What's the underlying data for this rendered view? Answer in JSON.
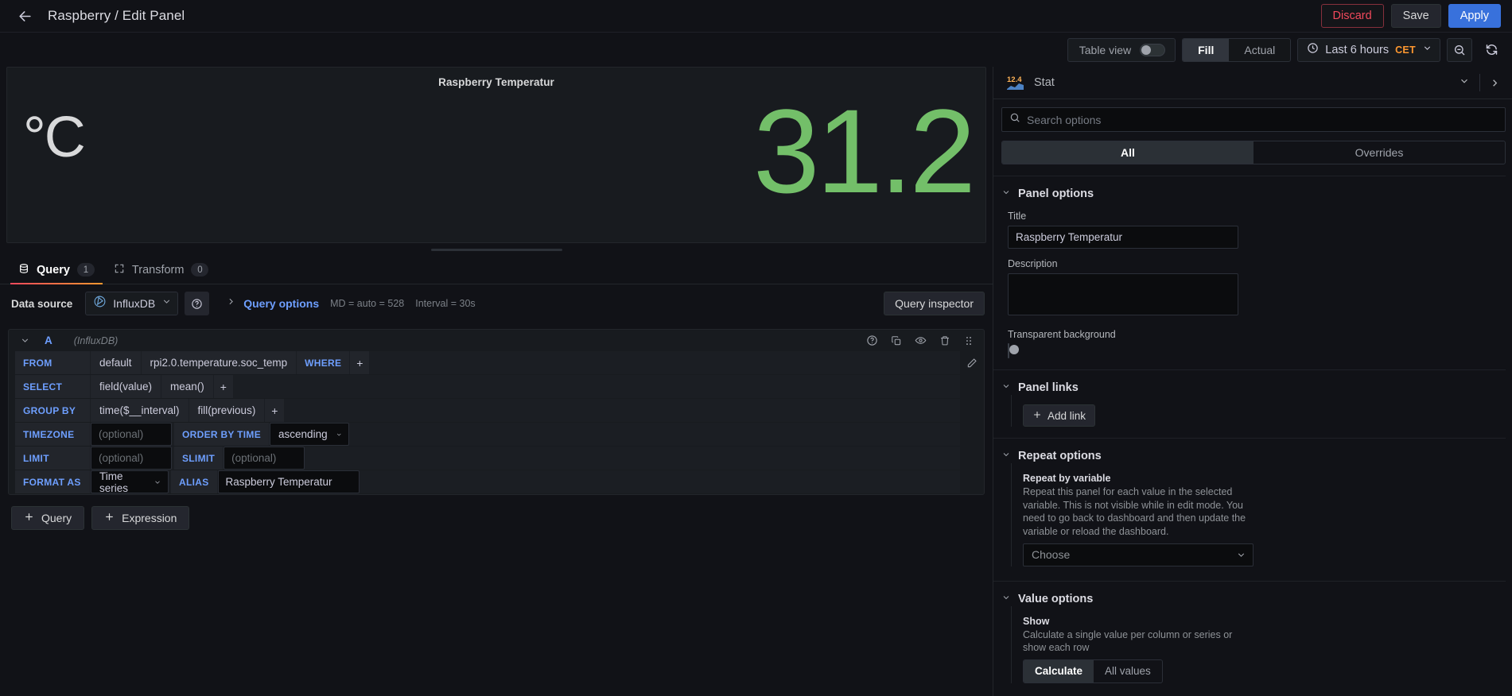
{
  "topbar": {
    "back_icon": "arrow-left-icon",
    "breadcrumb": "Raspberry / Edit Panel",
    "discard_label": "Discard",
    "save_label": "Save",
    "apply_label": "Apply"
  },
  "subbar": {
    "table_view_label": "Table view",
    "table_view_on": false,
    "fill_label": "Fill",
    "actual_label": "Actual",
    "fill_active": true,
    "time_range": "Last 6 hours",
    "timezone": "CET",
    "zoom_out_icon": "zoom-out-icon",
    "refresh_icon": "refresh-icon"
  },
  "panel_preview": {
    "title": "Raspberry Temperatur",
    "unit": "°C",
    "value": "31.2",
    "value_color": "#73bf69"
  },
  "query_tabs": {
    "query_label": "Query",
    "query_count": "1",
    "transform_label": "Transform",
    "transform_count": "0"
  },
  "datasource_row": {
    "label": "Data source",
    "name": "InfluxDB",
    "help_icon": "question-circle-icon",
    "query_options_label": "Query options",
    "md_text": "MD = auto = 528",
    "interval_text": "Interval = 30s",
    "query_inspector_label": "Query inspector"
  },
  "query_editor": {
    "ref_id": "A",
    "datasource_note": "(InfluxDB)",
    "rows": {
      "from": {
        "key": "FROM",
        "policy": "default",
        "measurement": "rpi2.0.temperature.soc_temp",
        "where_key": "WHERE",
        "plus": "+"
      },
      "select": {
        "key": "SELECT",
        "field": "field(value)",
        "agg": "mean()",
        "plus": "+"
      },
      "group_by": {
        "key": "GROUP BY",
        "time": "time($__interval)",
        "fill": "fill(previous)",
        "plus": "+"
      },
      "timezone": {
        "key": "TIMEZONE",
        "value": "",
        "placeholder": "(optional)",
        "order_key": "ORDER BY TIME",
        "order_value": "ascending"
      },
      "limit": {
        "key": "LIMIT",
        "value": "",
        "placeholder": "(optional)",
        "slimit_key": "SLIMIT",
        "slimit_value": "",
        "slimit_placeholder": "(optional)"
      },
      "format": {
        "key": "FORMAT AS",
        "value": "Time series",
        "alias_key": "ALIAS",
        "alias_value": "Raspberry Temperatur"
      }
    },
    "actions": {
      "help": "help-icon",
      "duplicate": "copy-icon",
      "hide": "eye-icon",
      "remove": "trash-icon",
      "drag": "drag-handle-icon",
      "edit": "pencil-icon"
    },
    "add_query_label": "Query",
    "add_expression_label": "Expression"
  },
  "options_pane": {
    "viz_name": "Stat",
    "viz_icon_number": "12.4",
    "search_placeholder": "Search options",
    "tab_all": "All",
    "tab_overrides": "Overrides",
    "groups": {
      "panel_options": {
        "title": "Panel options",
        "title_label": "Title",
        "title_value": "Raspberry Temperatur",
        "description_label": "Description",
        "description_value": "",
        "transparent_label": "Transparent background",
        "transparent_on": false
      },
      "panel_links": {
        "title": "Panel links",
        "add_link_label": "Add link"
      },
      "repeat_options": {
        "title": "Repeat options",
        "field_label": "Repeat by variable",
        "field_desc": "Repeat this panel for each value in the selected variable. This is not visible while in edit mode. You need to go back to dashboard and then update the variable or reload the dashboard.",
        "select_value": "Choose"
      },
      "value_options": {
        "title": "Value options",
        "show_label": "Show",
        "show_desc": "Calculate a single value per column or series or show each row",
        "calculate_label": "Calculate",
        "all_values_label": "All values",
        "calculate_active": true
      }
    }
  }
}
